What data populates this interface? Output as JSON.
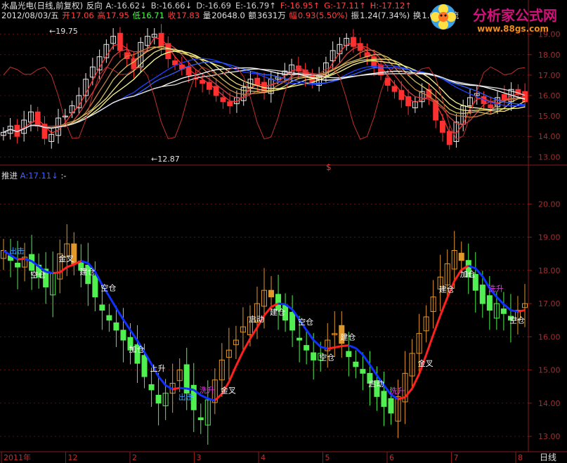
{
  "header": {
    "stock_name": "水晶光电(日线,前复权)",
    "mode": "反向",
    "fields": [
      {
        "label": "A:",
        "value": "-16.62",
        "arrow": "↓",
        "color": "#d0d0d0"
      },
      {
        "label": "B:",
        "value": "-16.66",
        "arrow": "↓",
        "color": "#d0d0d0"
      },
      {
        "label": "D:",
        "value": "-16.69",
        "arrow": "",
        "color": "#d0d0d0"
      },
      {
        "label": "E:",
        "value": "-16.79",
        "arrow": "↑",
        "color": "#d0d0d0"
      },
      {
        "label": "F:",
        "value": "-16.95",
        "arrow": "↑",
        "color": "#ff4040"
      },
      {
        "label": "G:",
        "value": "-17.11",
        "arrow": "↑",
        "color": "#ff4040"
      },
      {
        "label": "H:",
        "value": "-17.12",
        "arrow": "↑",
        "color": "#ff4040"
      }
    ],
    "date": "2012/08/03/五",
    "open_label": "开",
    "open": "17.06",
    "high_label": "高",
    "high": "17.95",
    "low_label": "低",
    "low": "16.71",
    "close_label": "收",
    "close": "17.83",
    "volume_label": "量",
    "volume": "20648.0",
    "amount_label": "额",
    "amount": "3631万",
    "change_label": "幅",
    "change": "0.93(5.50%)",
    "amplitude_label": "振",
    "amplitude": "1.24(7.34%)",
    "turnover_label": "换",
    "turnover": "1.01%",
    "extra": "流"
  },
  "indicator_header": {
    "name": "推进",
    "a_label": "A:",
    "a_value": "17.11",
    "a_arrow": "↓",
    "suffix": ":-"
  },
  "watermark": {
    "title": "分析家公式网",
    "url": "www.88gs.com"
  },
  "bottom_axis": {
    "labels": [
      "2011年",
      "12",
      "2",
      "3",
      "4",
      "5",
      "6",
      "7",
      "8"
    ],
    "period": "日线"
  },
  "colors": {
    "up": "#ff3030",
    "down_price": "#e8e8e8",
    "green": "#50f050",
    "orange": "#e0982a",
    "blue_line": "#1030ff",
    "red_line": "#ff2020",
    "magenta": "#e040e0",
    "grid": "#8a1a1a"
  },
  "chart_data": [
    {
      "type": "candlestick",
      "title": "水晶光电(日线,前复权)",
      "ylim": [
        12.7,
        19.3
      ],
      "y_ticks": [
        13.0,
        14.0,
        15.0,
        16.0,
        17.0,
        18.0,
        19.0
      ],
      "annotations": [
        {
          "text": "19.75",
          "kind": "max"
        },
        {
          "text": "12.87",
          "kind": "min"
        },
        {
          "text": "$",
          "kind": "marker"
        }
      ],
      "close_series": [
        14.2,
        14.5,
        14.0,
        14.8,
        15.2,
        14.5,
        13.9,
        14.1,
        14.9,
        15.0,
        15.5,
        16.0,
        16.8,
        17.4,
        17.9,
        18.5,
        18.9,
        18.2,
        17.8,
        17.3,
        18.6,
        18.9,
        19.0,
        18.4,
        17.8,
        17.5,
        17.3,
        17.0,
        16.8,
        16.6,
        16.3,
        16.0,
        15.7,
        15.5,
        15.9,
        16.4,
        16.8,
        16.5,
        16.2,
        16.8,
        16.9,
        17.2,
        17.5,
        17.2,
        16.9,
        16.6,
        17.0,
        17.6,
        18.2,
        18.5,
        18.8,
        18.4,
        18.2,
        17.9,
        17.4,
        17.0,
        16.5,
        16.2,
        15.8,
        15.5,
        15.7,
        16.2,
        15.9,
        14.8,
        14.2,
        13.6,
        14.7,
        15.5,
        15.9,
        16.1,
        15.6,
        15.4,
        15.9,
        15.8,
        16.3,
        16.1,
        15.7
      ]
    },
    {
      "type": "candlestick",
      "title": "推进",
      "ylim": [
        12.6,
        20.6
      ],
      "y_ticks": [
        13.0,
        14.0,
        15.0,
        16.0,
        17.0,
        18.0,
        19.0,
        20.0
      ],
      "series": [
        {
          "name": "A",
          "last_value": 17.11
        }
      ],
      "annotations": [
        "出击",
        "空仓",
        "金叉",
        "建仓",
        "空仓",
        "加仓",
        "上升",
        "出击",
        "洗升",
        "金叉",
        "启动",
        "建仓",
        "空仓",
        "空仓",
        "建仓",
        "启动",
        "洗升",
        "金叉",
        "建仓",
        "加仓",
        "洗升",
        "空仓"
      ],
      "close_series": [
        18.6,
        18.3,
        18.1,
        18.4,
        18.0,
        17.8,
        17.5,
        17.9,
        18.5,
        18.8,
        18.2,
        18.0,
        17.6,
        17.2,
        16.8,
        16.5,
        16.2,
        15.9,
        15.6,
        15.2,
        14.8,
        14.4,
        14.0,
        14.3,
        14.6,
        15.0,
        14.3,
        13.8,
        13.5,
        14.1,
        14.7,
        15.3,
        15.6,
        15.9,
        16.3,
        16.6,
        17.0,
        17.4,
        17.2,
        16.8,
        16.5,
        16.2,
        15.9,
        15.6,
        15.3,
        15.5,
        15.9,
        16.1,
        15.8,
        15.4,
        15.1,
        14.9,
        14.6,
        14.2,
        13.9,
        13.7,
        14.2,
        14.9,
        15.5,
        16.1,
        16.6,
        17.2,
        17.8,
        18.2,
        18.6,
        18.3,
        17.8,
        17.4,
        17.0,
        16.8,
        17.0,
        16.7,
        16.5,
        16.8,
        17.0
      ]
    }
  ]
}
